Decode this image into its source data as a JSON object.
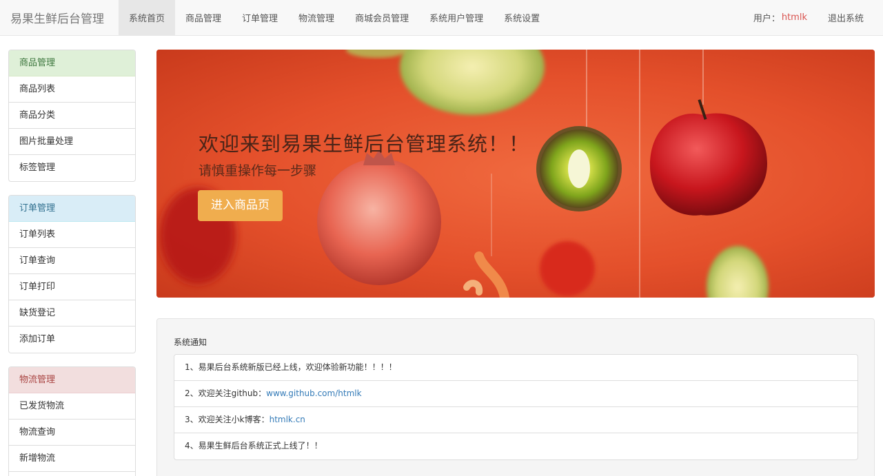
{
  "navbar": {
    "brand": "易果生鲜后台管理",
    "items": [
      {
        "label": "系统首页",
        "active": true
      },
      {
        "label": "商品管理"
      },
      {
        "label": "订单管理"
      },
      {
        "label": "物流管理"
      },
      {
        "label": "商城会员管理"
      },
      {
        "label": "系统用户管理"
      },
      {
        "label": "系统设置"
      }
    ],
    "user_label": "用户：",
    "username": "htmlk",
    "logout": "退出系统"
  },
  "sidebar": {
    "goods": {
      "heading": "商品管理",
      "items": [
        "商品列表",
        "商品分类",
        "图片批量处理",
        "标签管理"
      ]
    },
    "orders": {
      "heading": "订单管理",
      "items": [
        "订单列表",
        "订单查询",
        "订单打印",
        "缺货登记",
        "添加订单"
      ]
    },
    "logistics": {
      "heading": "物流管理",
      "items": [
        "已发货物流",
        "物流查询",
        "新增物流"
      ]
    }
  },
  "banner": {
    "title": "欢迎来到易果生鲜后台管理系统！！",
    "subtitle": "请慎重操作每一步骤",
    "button": "进入商品页"
  },
  "notice": {
    "title": "系统通知",
    "items": [
      {
        "text": "1、易果后台系统新版已经上线，欢迎体验新功能！！！！",
        "link": ""
      },
      {
        "text": "2、欢迎关注github：",
        "link": "www.github.com/htmlk"
      },
      {
        "text": "3、欢迎关注小k博客：",
        "link": "htmlk.cn"
      },
      {
        "text": "4、易果生鲜后台系统正式上线了！！",
        "link": ""
      }
    ]
  },
  "colors": {
    "banner_bg": "#e4502b",
    "banner_button": "#f0ad4e",
    "username": "#d9534f",
    "link": "#337ab7"
  }
}
